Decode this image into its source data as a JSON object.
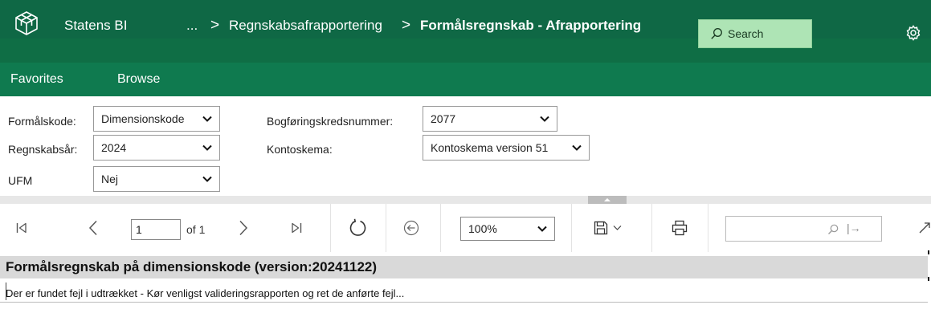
{
  "header": {
    "app_name": "Statens BI",
    "breadcrumb": {
      "ellipsis": "...",
      "parent": "Regnskabsafrapportering",
      "current": "Formålsregnskab - Afrapportering",
      "separator": ">"
    },
    "search": {
      "label": "Search",
      "icon": "search-icon"
    },
    "settings_icon": "gear-icon",
    "colors": {
      "bar": "#0f6845",
      "nav": "#0f7a4f",
      "search_bg": "#aee4b5"
    }
  },
  "nav": {
    "favorites": "Favorites",
    "browse": "Browse"
  },
  "params": {
    "formaalskode": {
      "label": "Formålskode:",
      "value": "Dimensionskode"
    },
    "bogforingskreds": {
      "label": "Bogføringskredsnummer:",
      "value": "2077"
    },
    "regnskabsaar": {
      "label": "Regnskabsår:",
      "value": "2024"
    },
    "kontoskema": {
      "label": "Kontoskema:",
      "value": "Kontoskema version 51"
    },
    "ufm": {
      "label": "UFM",
      "value": "Nej"
    }
  },
  "toolbar": {
    "page_number": "1",
    "of_label": "of 1",
    "zoom": "100%",
    "find_next": "|→"
  },
  "report": {
    "title": "Formålsregnskab på dimensionskode (version:20241122)",
    "message": "Der er fundet fejl i udtrækket - Kør venligst valideringsrapporten og ret de anførte fejl..."
  }
}
